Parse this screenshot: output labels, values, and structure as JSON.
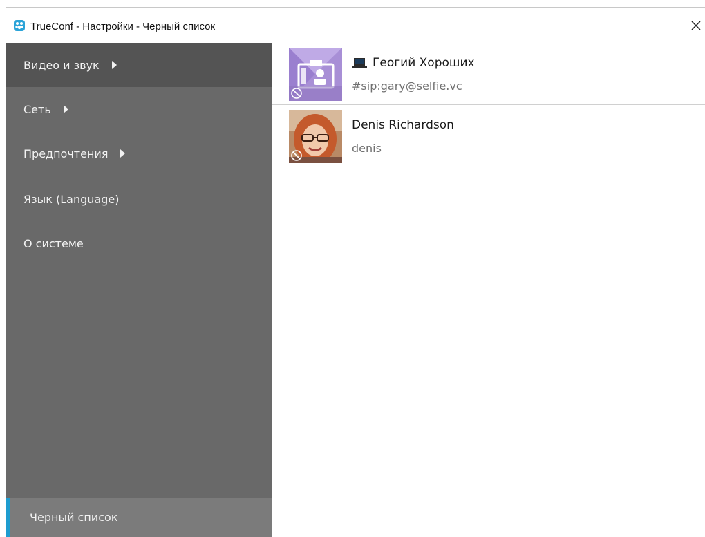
{
  "window": {
    "title": "TrueConf - Настройки - Черный список",
    "close_label": "Close"
  },
  "sidebar": {
    "items": [
      {
        "label": "Видео и звук",
        "has_submenu": true,
        "active": true
      },
      {
        "label": "Сеть",
        "has_submenu": true,
        "active": false
      },
      {
        "label": "Предпочтения",
        "has_submenu": true,
        "active": false
      },
      {
        "label": "Язык (Language)",
        "has_submenu": false,
        "active": false
      },
      {
        "label": "О системе",
        "has_submenu": false,
        "active": false
      }
    ],
    "blacklist": {
      "label": "Черный список",
      "selected": true
    }
  },
  "blacklist": {
    "contacts": [
      {
        "name": "Геогий Хороших",
        "id": "#sip:gary@selfie.vc",
        "icon": "laptop-icon",
        "avatar": "placeholder-avatar",
        "blocked": true
      },
      {
        "name": "Denis Richardson",
        "id": "denis",
        "icon": "",
        "avatar": "photo-avatar",
        "blocked": true
      }
    ]
  },
  "colors": {
    "sidebar_bg": "#696969",
    "sidebar_active": "#545454",
    "selected_item_bg": "#7b7b7b",
    "accent": "#1e9ccf",
    "placeholder_avatar": "#a88fd6"
  }
}
